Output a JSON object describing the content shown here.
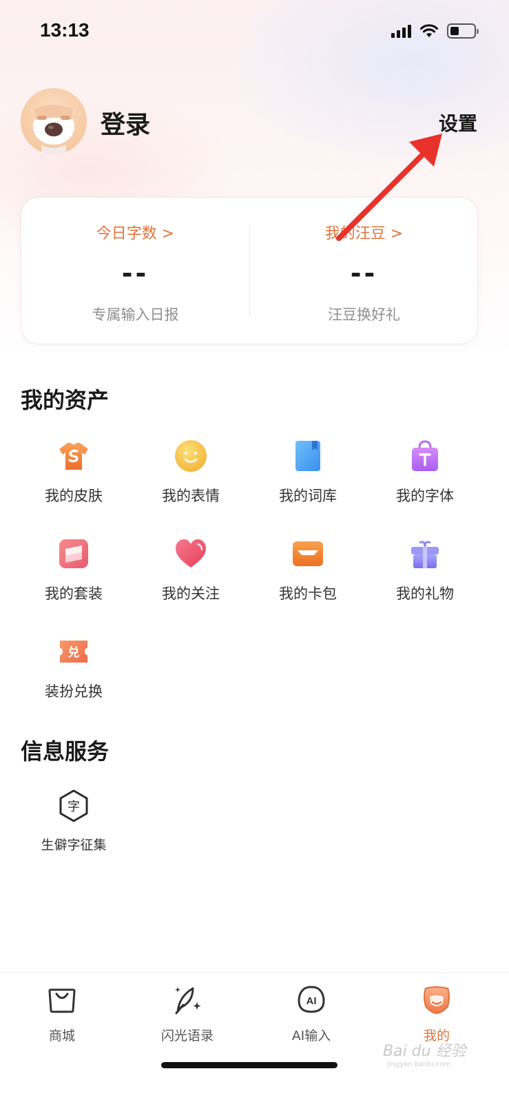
{
  "status_bar": {
    "time": "13:13",
    "icons": [
      "signal-icon",
      "wifi-icon",
      "battery-icon"
    ]
  },
  "header": {
    "avatar": "avatar",
    "login_label": "登录",
    "settings_label": "设置"
  },
  "stats": {
    "today_words": {
      "link": "今日字数 >",
      "value": "--",
      "sub": "专属输入日报"
    },
    "my_beans": {
      "link": "我的汪豆 >",
      "value": "--",
      "sub": "汪豆换好礼"
    }
  },
  "assets": {
    "title": "我的资产",
    "items": [
      {
        "label": "我的皮肤",
        "icon": "tshirt-icon"
      },
      {
        "label": "我的表情",
        "icon": "smile-icon"
      },
      {
        "label": "我的词库",
        "icon": "book-icon"
      },
      {
        "label": "我的字体",
        "icon": "font-bag-icon"
      },
      {
        "label": "我的套装",
        "icon": "suit-icon"
      },
      {
        "label": "我的关注",
        "icon": "heart-icon"
      },
      {
        "label": "我的卡包",
        "icon": "card-wallet-icon"
      },
      {
        "label": "我的礼物",
        "icon": "gift-icon"
      },
      {
        "label": "装扮兑换",
        "icon": "exchange-ticket-icon",
        "icon_text": "兑"
      }
    ]
  },
  "services": {
    "title": "信息服务",
    "items": [
      {
        "label": "生僻字征集",
        "icon": "rare-character-icon",
        "icon_text": "字"
      }
    ]
  },
  "bottom_nav": {
    "items": [
      {
        "label": "商城",
        "icon": "shop-bag-icon",
        "active": false
      },
      {
        "label": "闪光语录",
        "icon": "feather-sparkle-icon",
        "active": false
      },
      {
        "label": "AI输入",
        "icon": "ai-input-icon",
        "icon_text": "AI",
        "active": false
      },
      {
        "label": "我的",
        "icon": "profile-face-icon",
        "active": true
      }
    ]
  },
  "watermark": {
    "text": "Bai du 经验",
    "sub": "jingyan.baidu.com"
  },
  "colors": {
    "accent": "#e0733b",
    "annotation_arrow": "#e8322b",
    "text_primary": "#1a1a1a",
    "text_secondary": "#8e8e8e"
  }
}
